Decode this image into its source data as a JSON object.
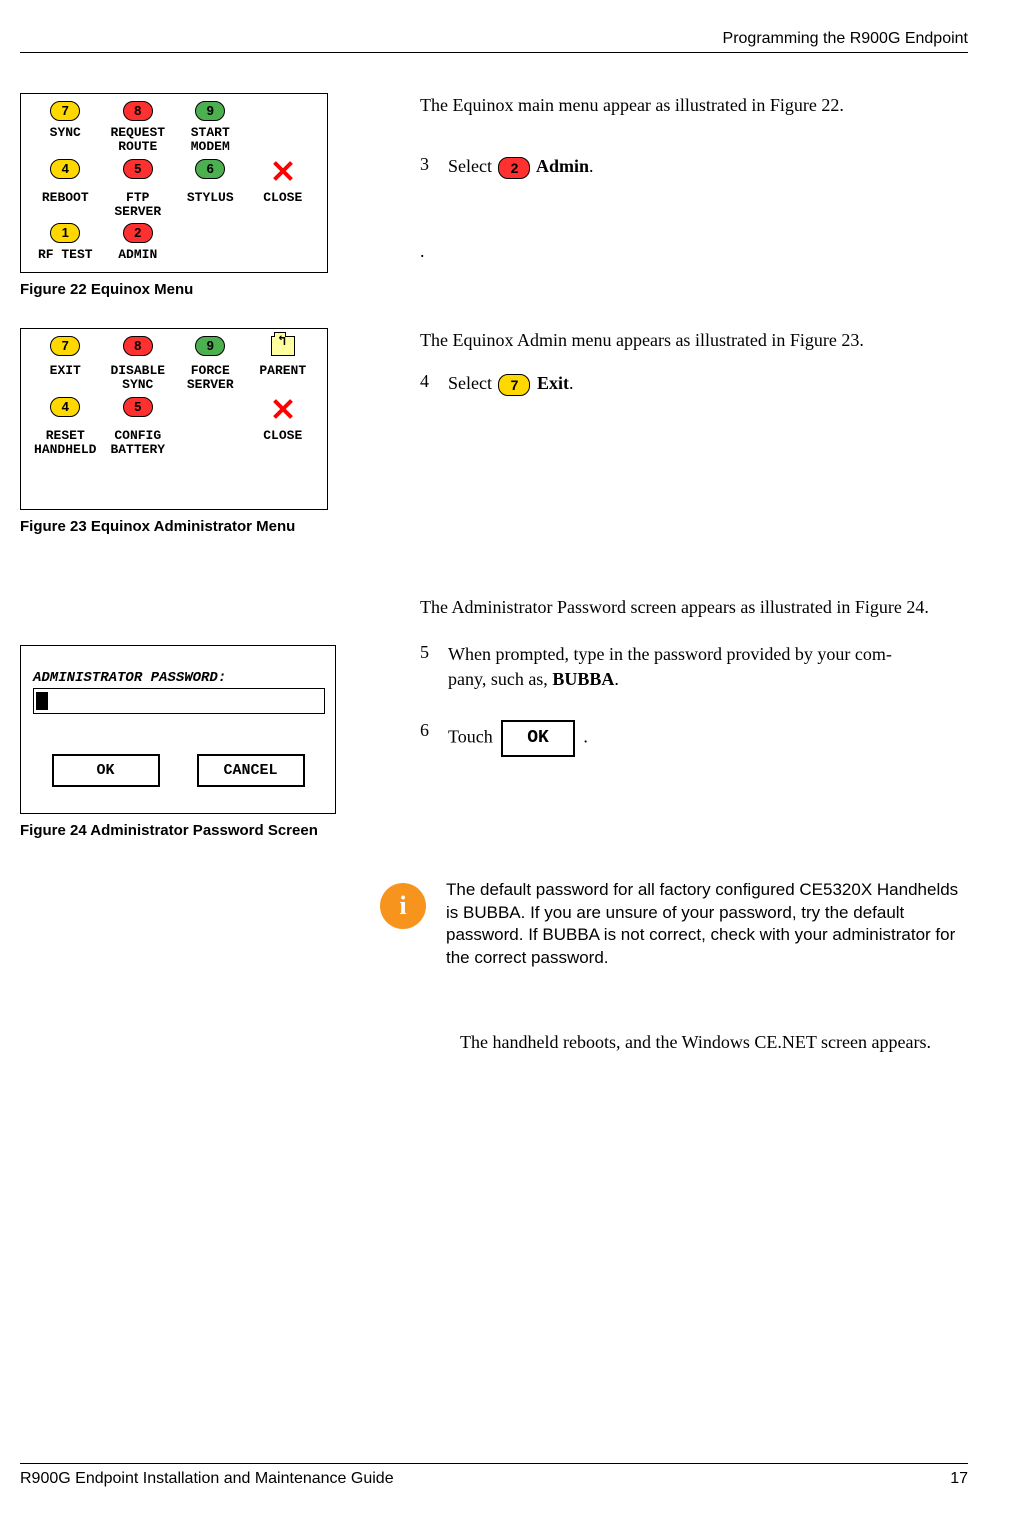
{
  "header": {
    "section_title": "Programming the R900G Endpoint"
  },
  "figure22": {
    "caption": "Figure 22  Equinox Menu",
    "items": {
      "r1": [
        {
          "n": "7",
          "lbl": "SYNC"
        },
        {
          "n": "8",
          "lbl": "REQUEST\nROUTE"
        },
        {
          "n": "9",
          "lbl": "START\nMODEM"
        }
      ],
      "r2": [
        {
          "n": "4",
          "lbl": "REBOOT"
        },
        {
          "n": "5",
          "lbl": "FTP\nSERVER"
        },
        {
          "n": "6",
          "lbl": "STYLUS"
        }
      ],
      "close": "CLOSE",
      "r3": [
        {
          "n": "1",
          "lbl": "RF TEST"
        },
        {
          "n": "2",
          "lbl": "ADMIN"
        }
      ]
    }
  },
  "figure23": {
    "caption": "Figure 23  Equinox Administrator Menu",
    "items": {
      "r1": [
        {
          "n": "7",
          "lbl": "EXIT"
        },
        {
          "n": "8",
          "lbl": "DISABLE\nSYNC"
        },
        {
          "n": "9",
          "lbl": "FORCE\nSERVER"
        }
      ],
      "parent": "PARENT",
      "r2": [
        {
          "n": "4",
          "lbl": "RESET\nHANDHELD"
        },
        {
          "n": "5",
          "lbl": "CONFIG\nBATTERY"
        }
      ],
      "close": "CLOSE"
    }
  },
  "figure24": {
    "caption": "Figure 24  Administrator Password Screen",
    "label": "ADMINISTRATOR PASSWORD:",
    "ok": "OK",
    "cancel": "CANCEL"
  },
  "body": {
    "p1": "The Equinox main menu appear as illustrated in Figure 22.",
    "step3_num": "3",
    "step3_a": "Select ",
    "step3_btn": "2",
    "step3_b": " Admin",
    "step3_c": ".",
    "dot": ".",
    "p2": "The Equinox Admin menu appears as illustrated in Figure 23.",
    "step4_num": "4",
    "step4_a": "Select ",
    "step4_btn": "7",
    "step4_b": " Exit",
    "step4_c": ".",
    "p3": "The Administrator Password screen appears as illustrated in Figure 24.",
    "step5_num": "5",
    "step5_a": "When prompted, type in the password provided by your com-",
    "step5_b": "pany, such as, ",
    "step5_bold": "BUBBA",
    "step5_c": ".",
    "step6_num": "6",
    "step6_a": "Touch ",
    "step6_ok": "OK",
    "step6_b": " .",
    "info": "The default password for all factory configured CE5320X Handhelds is BUBBA. If you are unsure of your password, try the default password. If BUBBA is not correct, check with your administrator for the correct pass­word.",
    "p4": "The handheld reboots, and the Windows CE.NET screen appears."
  },
  "footer": {
    "left": "R900G Endpoint Installation and Maintenance Guide",
    "right": "17"
  }
}
